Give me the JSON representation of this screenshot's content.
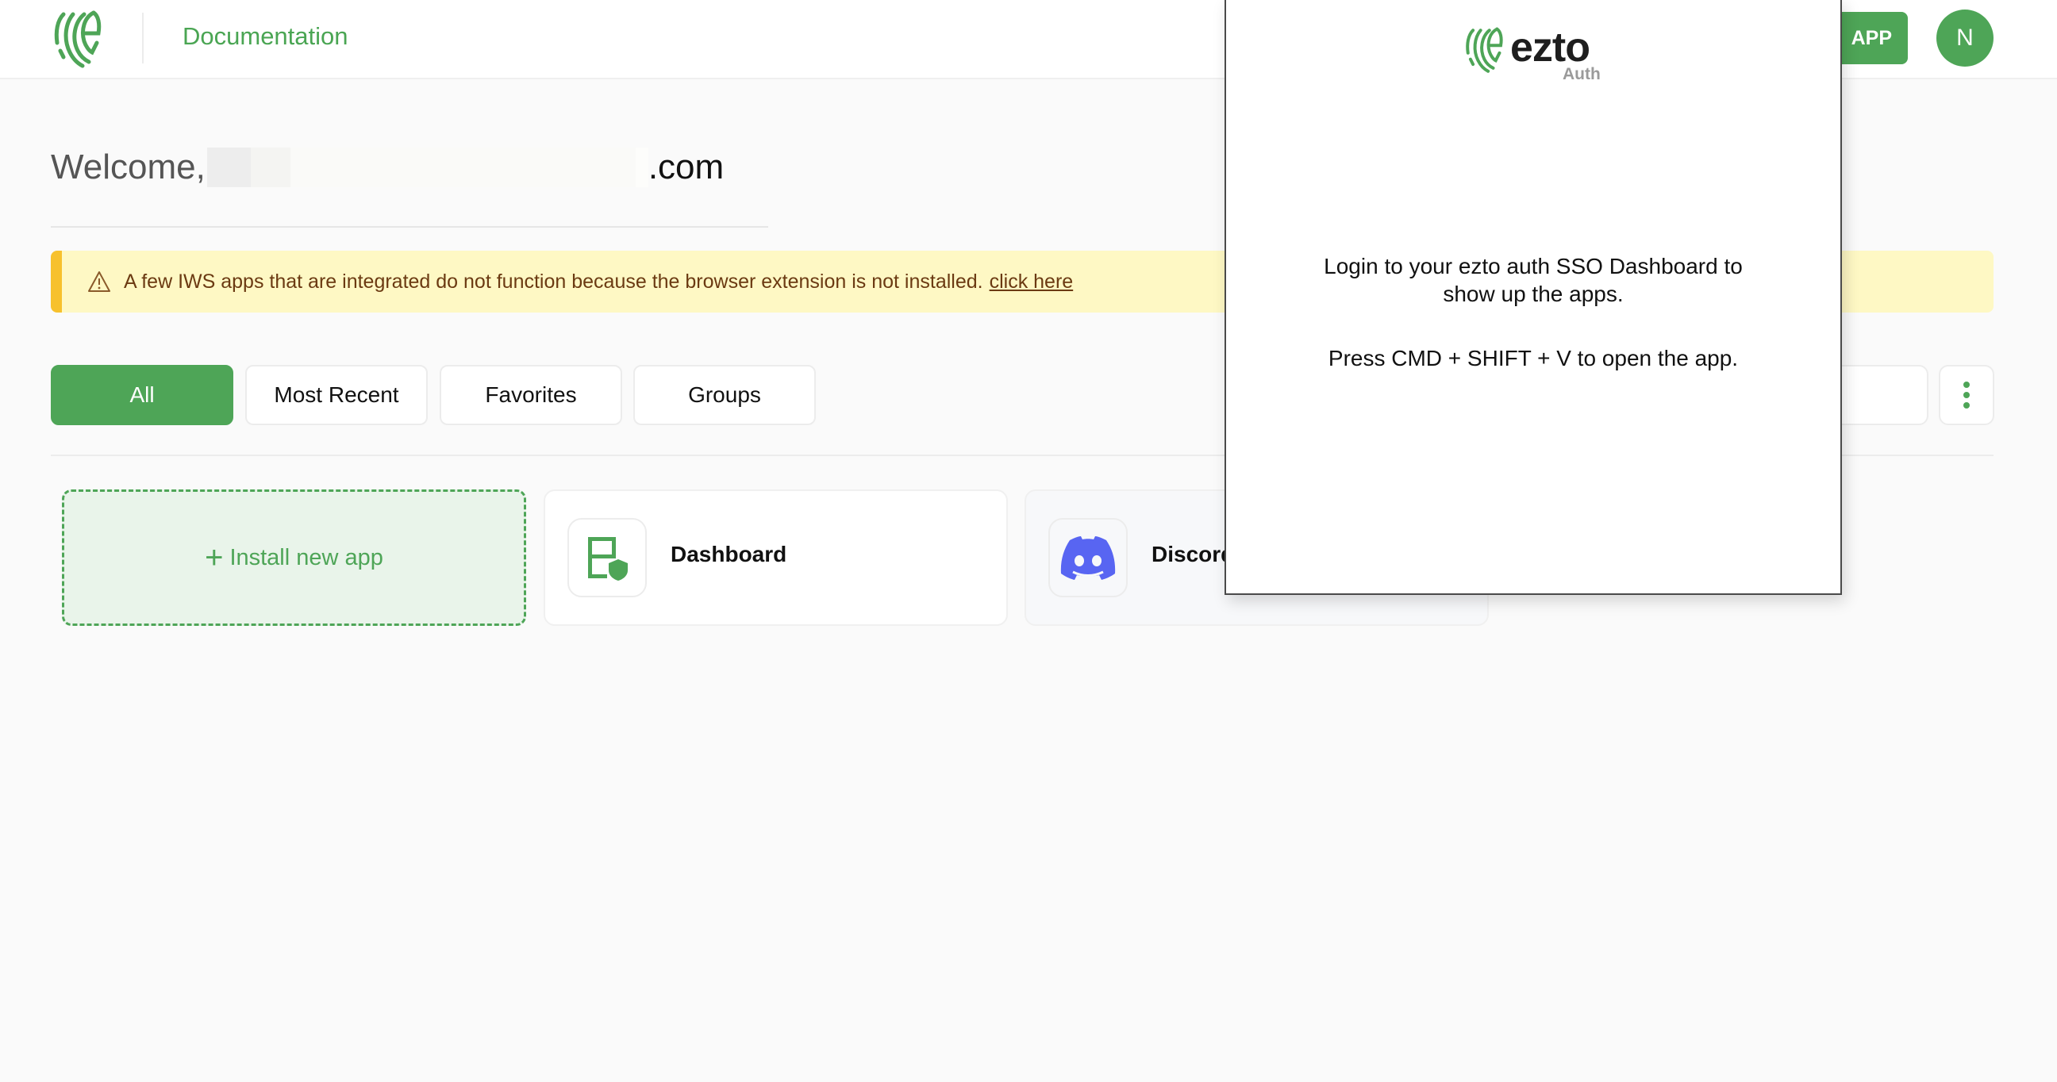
{
  "header": {
    "logo_icon": "ezto-fingerprint-logo",
    "documentation_label": "Documentation",
    "add_app_label": "ADD APP",
    "add_app_visible_label": "APP",
    "avatar_initial": "N"
  },
  "welcome": {
    "greeting": "Welcome,",
    "email_suffix": ".com"
  },
  "banner": {
    "icon": "warning-triangle-icon",
    "message": "A few IWS apps that are integrated do not function because the browser extension is not installed.",
    "link_label": "click here"
  },
  "tabs": [
    {
      "label": "All",
      "active": true
    },
    {
      "label": "Most Recent",
      "active": false
    },
    {
      "label": "Favorites",
      "active": false
    },
    {
      "label": "Groups",
      "active": false
    }
  ],
  "toolbar": {
    "search_placeholder": "",
    "more_icon": "kebab-menu-icon"
  },
  "apps": {
    "install_label": "Install new app",
    "items": [
      {
        "name": "Dashboard",
        "icon": "dashboard-shield-icon"
      },
      {
        "name": "Discord",
        "visible_name": "Discor",
        "icon": "discord-icon"
      }
    ]
  },
  "popup": {
    "brand": "ezto",
    "brand_sub": "Auth",
    "message": "Login to your ezto auth SSO Dashboard to show up the apps.",
    "hint": "Press CMD + SHIFT + V to open the app."
  },
  "colors": {
    "brand_green": "#4ea557",
    "banner_bg": "#fef8c4",
    "banner_accent": "#f7c12d",
    "banner_text": "#6b3a12",
    "discord_blurple": "#5865f2"
  }
}
